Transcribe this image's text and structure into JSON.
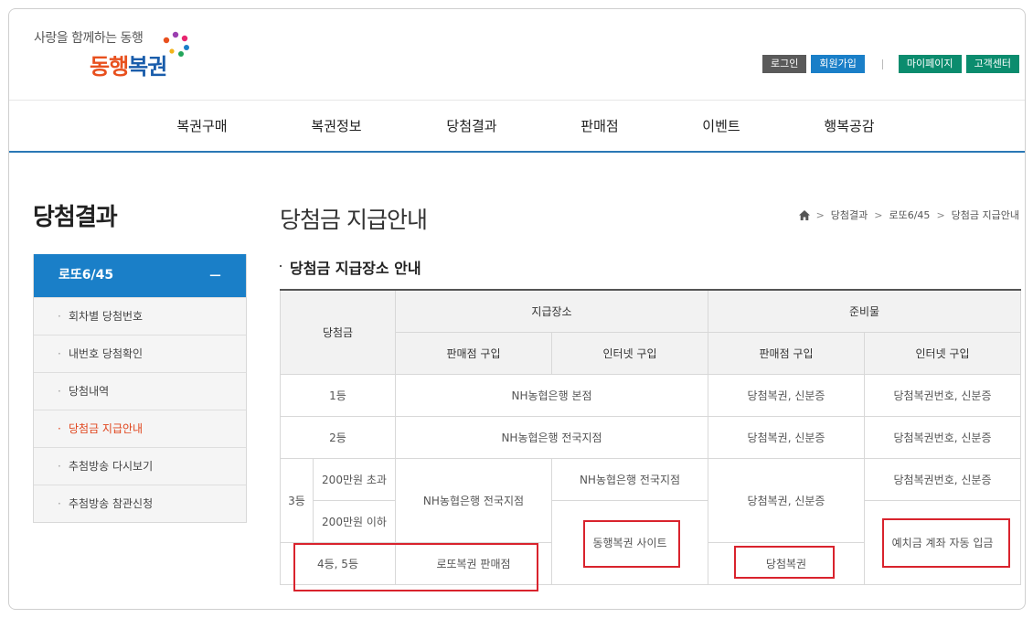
{
  "header": {
    "tagline": "사랑을 함께하는 동행",
    "logo_part1": "동행",
    "logo_part2": "복권",
    "buttons": {
      "login": "로그인",
      "signup": "회원가입",
      "mypage": "마이페이지",
      "support": "고객센터"
    },
    "colors": {
      "login": "#5a5a5a",
      "signup": "#1a7fc8",
      "mypage": "#0b8c6e",
      "support": "#0b8c6e"
    }
  },
  "nav": [
    "복권구매",
    "복권정보",
    "당첨결과",
    "판매점",
    "이벤트",
    "행복공감"
  ],
  "sidebar": {
    "title": "당첨결과",
    "section": "로또6/45",
    "collapse_symbol": "−",
    "items": [
      {
        "label": "회차별 당첨번호",
        "active": false
      },
      {
        "label": "내번호 당첨확인",
        "active": false
      },
      {
        "label": "당첨내역",
        "active": false
      },
      {
        "label": "당첨금 지급안내",
        "active": true
      },
      {
        "label": "추첨방송 다시보기",
        "active": false
      },
      {
        "label": "추첨방송 참관신청",
        "active": false
      }
    ]
  },
  "main": {
    "title": "당첨금 지급안내",
    "breadcrumb": [
      "당첨결과",
      "로또6/45",
      "당첨금 지급안내"
    ],
    "section_title": "당첨금 지급장소 안내",
    "table": {
      "h_prize": "당첨금",
      "h_place": "지급장소",
      "h_docs": "준비물",
      "h_store": "판매점 구입",
      "h_internet": "인터넷 구입",
      "rank1": "1등",
      "rank1_place": "NH농협은행 본점",
      "rank1_docs_store": "당첨복권, 신분증",
      "rank1_docs_internet": "당첨복권번호, 신분증",
      "rank2": "2등",
      "rank2_place": "NH농협은행 전국지점",
      "rank2_docs_store": "당첨복권, 신분증",
      "rank2_docs_internet": "당첨복권번호, 신분증",
      "rank3": "3등",
      "rank3_over": "200만원 초과",
      "rank3_under": "200만원 이하",
      "rank3_place_store": "NH농협은행 전국지점",
      "rank3_place_internet_over": "NH농협은행 전국지점",
      "rank3_docs_store": "당첨복권, 신분증",
      "rank3_docs_internet_over": "당첨복권번호, 신분증",
      "rank45": "4등, 5등",
      "rank45_place_store": "로또복권 판매점",
      "internet_small_place": "동행복권 사이트",
      "rank45_docs_store": "당첨복권",
      "internet_small_docs": "예치금 계좌 자동 입금"
    },
    "highlight_color": "#d9232d"
  }
}
